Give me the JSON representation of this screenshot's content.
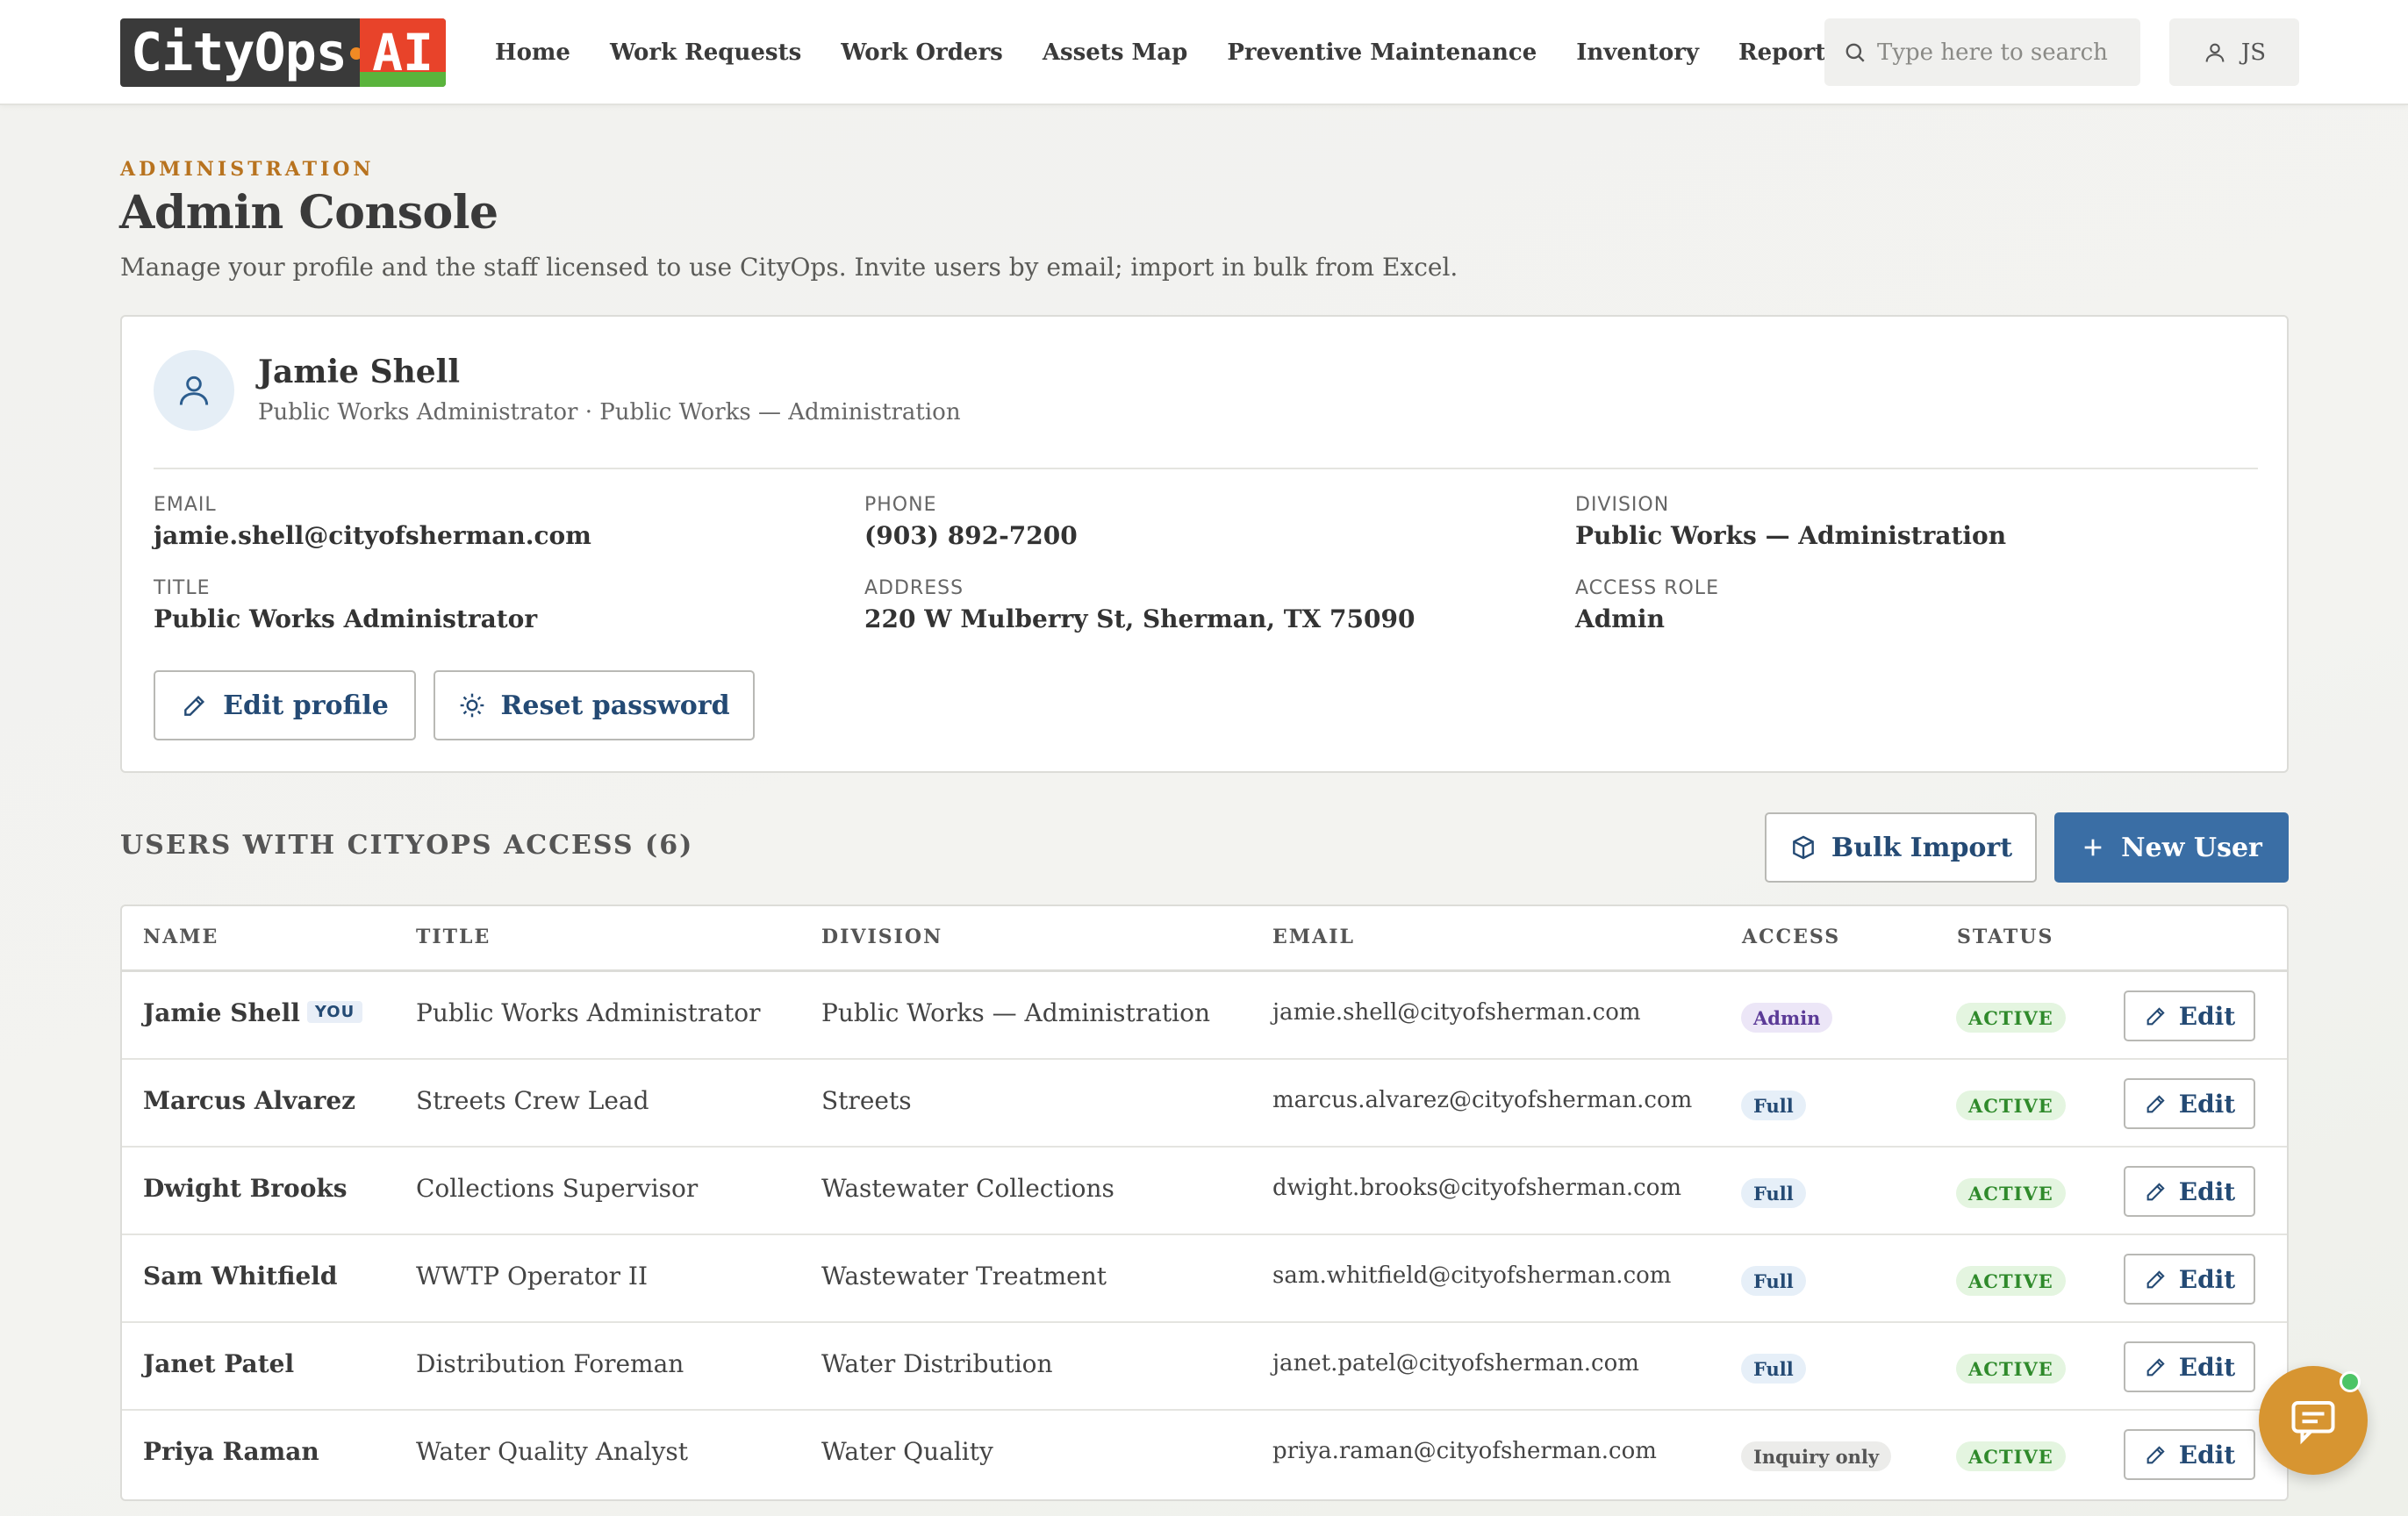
{
  "brand": {
    "name_main": "CityOps",
    "name_ai": "AI"
  },
  "nav": [
    "Home",
    "Work Requests",
    "Work Orders",
    "Assets Map",
    "Preventive Maintenance",
    "Inventory",
    "Reports"
  ],
  "search": {
    "placeholder": "Type here to search"
  },
  "user_menu": {
    "initials": "JS"
  },
  "page": {
    "eyebrow": "ADMINISTRATION",
    "title": "Admin Console",
    "subtitle": "Manage your profile and the staff licensed to use CityOps. Invite users by email; import in bulk from Excel."
  },
  "profile": {
    "name": "Jamie Shell",
    "role_line": "Public Works Administrator · Public Works — Administration",
    "fields": {
      "email_label": "EMAIL",
      "email": "jamie.shell@cityofsherman.com",
      "phone_label": "PHONE",
      "phone": "(903) 892-7200",
      "division_label": "DIVISION",
      "division": "Public Works — Administration",
      "title_label": "TITLE",
      "title": "Public Works Administrator",
      "address_label": "ADDRESS",
      "address": "220 W Mulberry St, Sherman, TX 75090",
      "access_label": "ACCESS ROLE",
      "access": "Admin"
    },
    "edit_label": "Edit profile",
    "reset_label": "Reset password"
  },
  "users": {
    "heading": "USERS WITH CITYOPS ACCESS (6)",
    "bulk_label": "Bulk Import",
    "new_label": "New User",
    "columns": [
      "NAME",
      "TITLE",
      "DIVISION",
      "EMAIL",
      "ACCESS",
      "STATUS"
    ],
    "you_badge": "YOU",
    "edit_label": "Edit",
    "rows": [
      {
        "name": "Jamie Shell",
        "title": "Public Works Administrator",
        "division": "Public Works — Administration",
        "email": "jamie.shell@cityofsherman.com",
        "access": "Admin",
        "status": "ACTIVE"
      },
      {
        "name": "Marcus Alvarez",
        "title": "Streets Crew Lead",
        "division": "Streets",
        "email": "marcus.alvarez@cityofsherman.com",
        "access": "Full",
        "status": "ACTIVE"
      },
      {
        "name": "Dwight Brooks",
        "title": "Collections Supervisor",
        "division": "Wastewater Collections",
        "email": "dwight.brooks@cityofsherman.com",
        "access": "Full",
        "status": "ACTIVE"
      },
      {
        "name": "Sam Whitfield",
        "title": "WWTP Operator II",
        "division": "Wastewater Treatment",
        "email": "sam.whitfield@cityofsherman.com",
        "access": "Full",
        "status": "ACTIVE"
      },
      {
        "name": "Janet Patel",
        "title": "Distribution Foreman",
        "division": "Water Distribution",
        "email": "janet.patel@cityofsherman.com",
        "access": "Full",
        "status": "ACTIVE"
      },
      {
        "name": "Priya Raman",
        "title": "Water Quality Analyst",
        "division": "Water Quality",
        "email": "priya.raman@cityofsherman.com",
        "access": "Inquiry only",
        "status": "ACTIVE"
      }
    ]
  },
  "colors": {
    "accent": "#3a6ea5",
    "eyebrow": "#b8731f",
    "active": "#2f8a2b",
    "chat": "#d79531"
  },
  "icons": [
    "search-icon",
    "user-icon",
    "pencil-icon",
    "gear-icon",
    "box-icon",
    "plus-icon",
    "chat-icon"
  ]
}
